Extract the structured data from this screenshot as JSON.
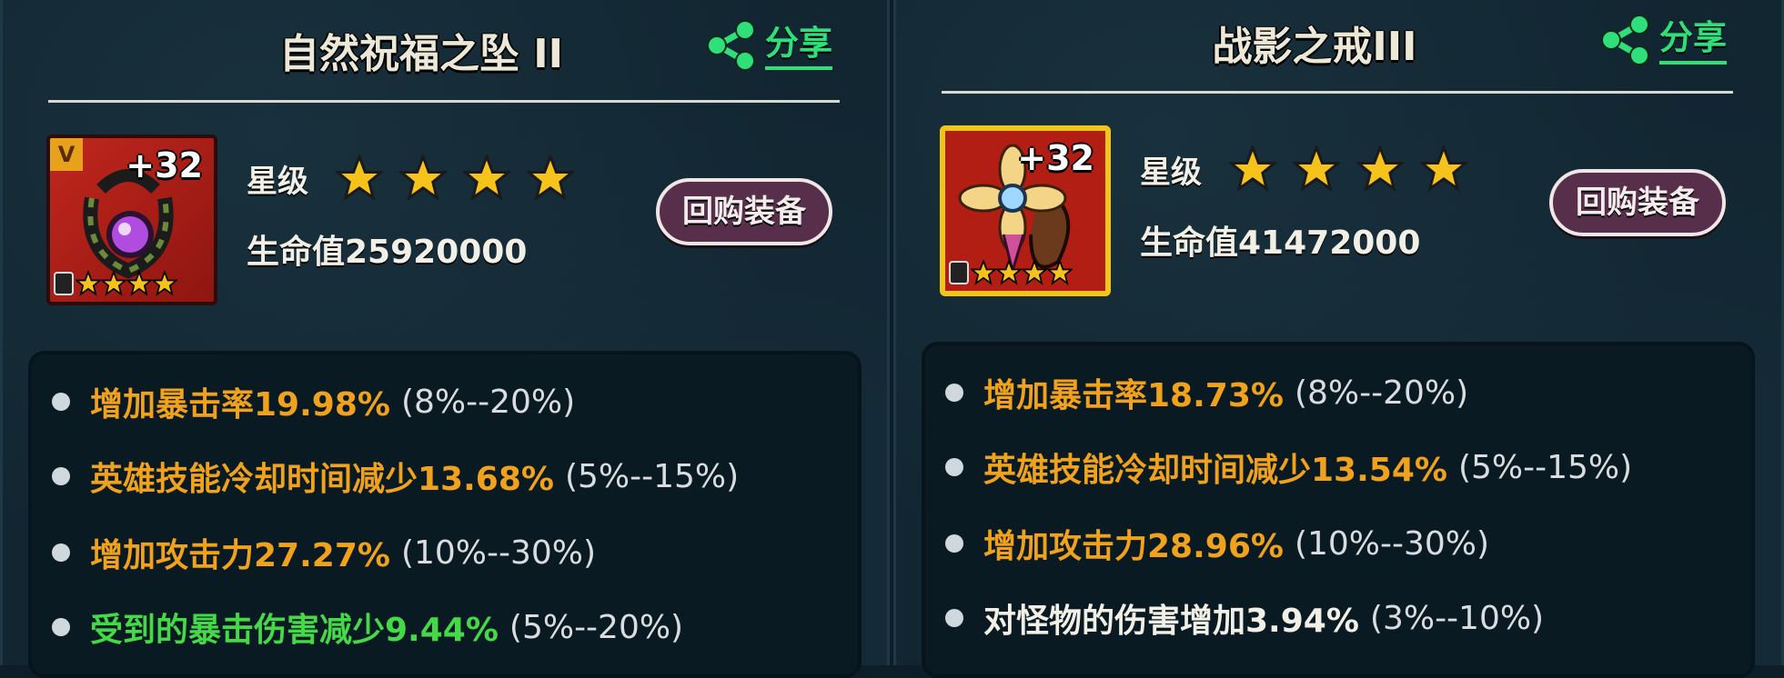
{
  "panels": [
    {
      "title": "自然祝福之坠 II",
      "share_label": "分享",
      "icon_badge": "V",
      "plus_level": "+32",
      "star_label": "星级",
      "life_text": "生命值25920000",
      "buyback_label": "回购装备",
      "stats": [
        {
          "text": "增加暴击率19.98%",
          "range": "(8%--20%)",
          "color": "orange"
        },
        {
          "text": "英雄技能冷却时间减少13.68%",
          "range": "(5%--15%)",
          "color": "orange"
        },
        {
          "text": "增加攻击力27.27%",
          "range": "(10%--30%)",
          "color": "orange"
        },
        {
          "text": "受到的暴击伤害减少9.44%",
          "range": "(5%--20%)",
          "color": "green"
        }
      ]
    },
    {
      "title": "战影之戒III",
      "share_label": "分享",
      "plus_level": "+32",
      "star_label": "星级",
      "life_text": "生命值41472000",
      "buyback_label": "回购装备",
      "stats": [
        {
          "text": "增加暴击率18.73%",
          "range": "(8%--20%)",
          "color": "orange"
        },
        {
          "text": "英雄技能冷却时间减少13.54%",
          "range": "(5%--15%)",
          "color": "orange"
        },
        {
          "text": "增加攻击力28.96%",
          "range": "(10%--30%)",
          "color": "orange"
        },
        {
          "text": "对怪物的伤害增加3.94%",
          "range": "(3%--10%)",
          "color": "white"
        }
      ]
    }
  ],
  "icons": {
    "share": "share-icon",
    "star": "star-icon",
    "lock": "lock-icon"
  },
  "star_count": 4,
  "mini_star_count": 4,
  "colors": {
    "orange": "#f0a21c",
    "green": "#45d94a",
    "share": "#2fe07a",
    "star": "#f6c21c"
  }
}
